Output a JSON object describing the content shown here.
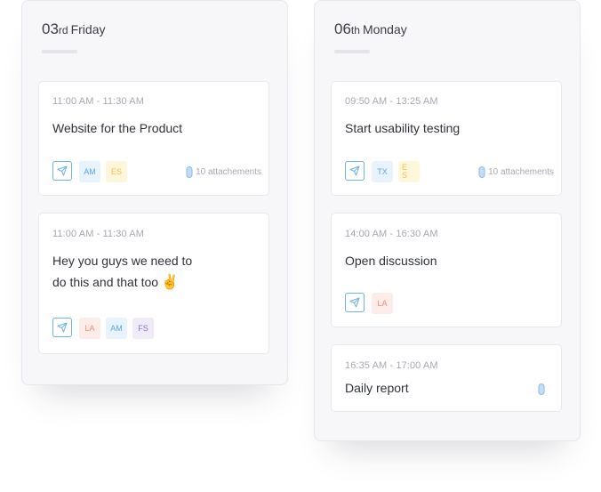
{
  "colors": {
    "accent_blue": "#6db1e6",
    "tag_blue_bg": "#e8f3fd",
    "tag_blue_fg": "#5aa7e3",
    "tag_yellow_bg": "#fff7dc",
    "tag_yellow_fg": "#f2c14e",
    "tag_red_bg": "#fdece8",
    "tag_red_fg": "#ef8c78",
    "tag_purple_bg": "#f0ebf9",
    "tag_purple_fg": "#8f6fd1"
  },
  "columns": [
    {
      "day_number": "03",
      "day_suffix": "rd",
      "day_name": "Friday",
      "cards": [
        {
          "time": "11:00 AM - 11:30 AM",
          "title_lines": [
            "Website for the Product"
          ],
          "emoji": "",
          "tags": [
            {
              "text": "AM",
              "color": "blue"
            },
            {
              "text": "ES",
              "color": "yellow"
            }
          ],
          "attachments": "10 attachements"
        },
        {
          "time": "11:00 AM - 11:30 AM",
          "title_lines": [
            "Hey you guys we need to",
            "do this and that too"
          ],
          "emoji": "✌️",
          "tags": [
            {
              "text": "LA",
              "color": "red"
            },
            {
              "text": "AM",
              "color": "blue"
            },
            {
              "text": "FS",
              "color": "purple"
            }
          ],
          "attachments": ""
        }
      ]
    },
    {
      "day_number": "06",
      "day_suffix": "th",
      "day_name": "Monday",
      "cards": [
        {
          "time": "09:50 AM - 13:25 AM",
          "title_lines": [
            "Start usability testing"
          ],
          "emoji": "",
          "tags": [
            {
              "text": "TX",
              "color": "blue"
            },
            {
              "text": "E S",
              "color": "yellow"
            }
          ],
          "attachments": "10 attachements"
        },
        {
          "time": "14:00 AM - 16:30 AM",
          "title_lines": [
            "Open discussion"
          ],
          "emoji": "",
          "tags": [
            {
              "text": "LA",
              "color": "red"
            }
          ],
          "attachments": ""
        },
        {
          "time": "16:35 AM - 17:00 AM",
          "title_lines": [
            "Daily report"
          ],
          "emoji": "",
          "tags": [],
          "attachments": "",
          "attachment_icon": "paperclip-icon"
        }
      ]
    }
  ],
  "icons": {
    "send": "paper-plane-icon",
    "attachment": "paperclip-icon"
  }
}
